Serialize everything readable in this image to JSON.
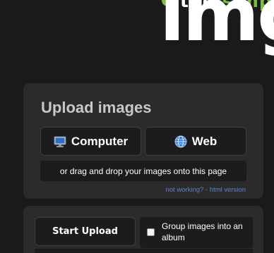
{
  "logo": {
    "tagline_white": "the",
    "tagline_green": "simple",
    "wordmark": "img",
    "accent_color": "#7ac143",
    "icon": "logo-dot-icon"
  },
  "upload": {
    "title": "Upload images",
    "computer_label": "Computer",
    "computer_icon": "monitor-icon",
    "web_label": "Web",
    "web_icon": "globe-icon",
    "drop_text": "or drag and drop your images onto this page",
    "alt_link": "not working? - html version",
    "link_color": "#5b84c8"
  },
  "actions": {
    "start_label": "Start Upload",
    "group_label": "Group images into an album",
    "group_checked": false
  }
}
